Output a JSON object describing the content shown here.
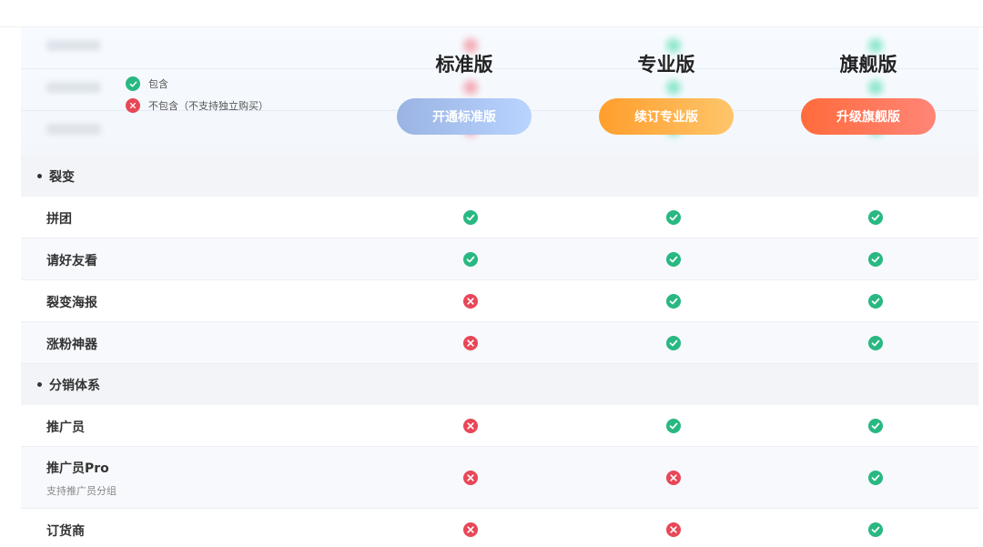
{
  "legend": {
    "included_label": "包含",
    "excluded_label": "不包含（不支持独立购买）"
  },
  "plans": [
    {
      "name": "标准版",
      "button": "开通标准版"
    },
    {
      "name": "专业版",
      "button": "续订专业版"
    },
    {
      "name": "旗舰版",
      "button": "升级旗舰版"
    }
  ],
  "sections": [
    {
      "title": "裂变",
      "rows": [
        {
          "label": "拼团",
          "sub": "",
          "values": [
            "included",
            "included",
            "included"
          ]
        },
        {
          "label": "请好友看",
          "sub": "",
          "values": [
            "included",
            "included",
            "included"
          ]
        },
        {
          "label": "裂变海报",
          "sub": "",
          "values": [
            "excluded",
            "included",
            "included"
          ]
        },
        {
          "label": "涨粉神器",
          "sub": "",
          "values": [
            "excluded",
            "included",
            "included"
          ]
        }
      ]
    },
    {
      "title": "分销体系",
      "rows": [
        {
          "label": "推广员",
          "sub": "",
          "values": [
            "excluded",
            "included",
            "included"
          ]
        },
        {
          "label": "推广员Pro",
          "sub": "支持推广员分组",
          "values": [
            "excluded",
            "excluded",
            "included"
          ]
        },
        {
          "label": "订货商",
          "sub": "",
          "values": [
            "excluded",
            "excluded",
            "included"
          ]
        }
      ]
    }
  ],
  "colors": {
    "included": "#29b882",
    "excluded": "#e84757",
    "section_bg": "#f2f4f7"
  }
}
